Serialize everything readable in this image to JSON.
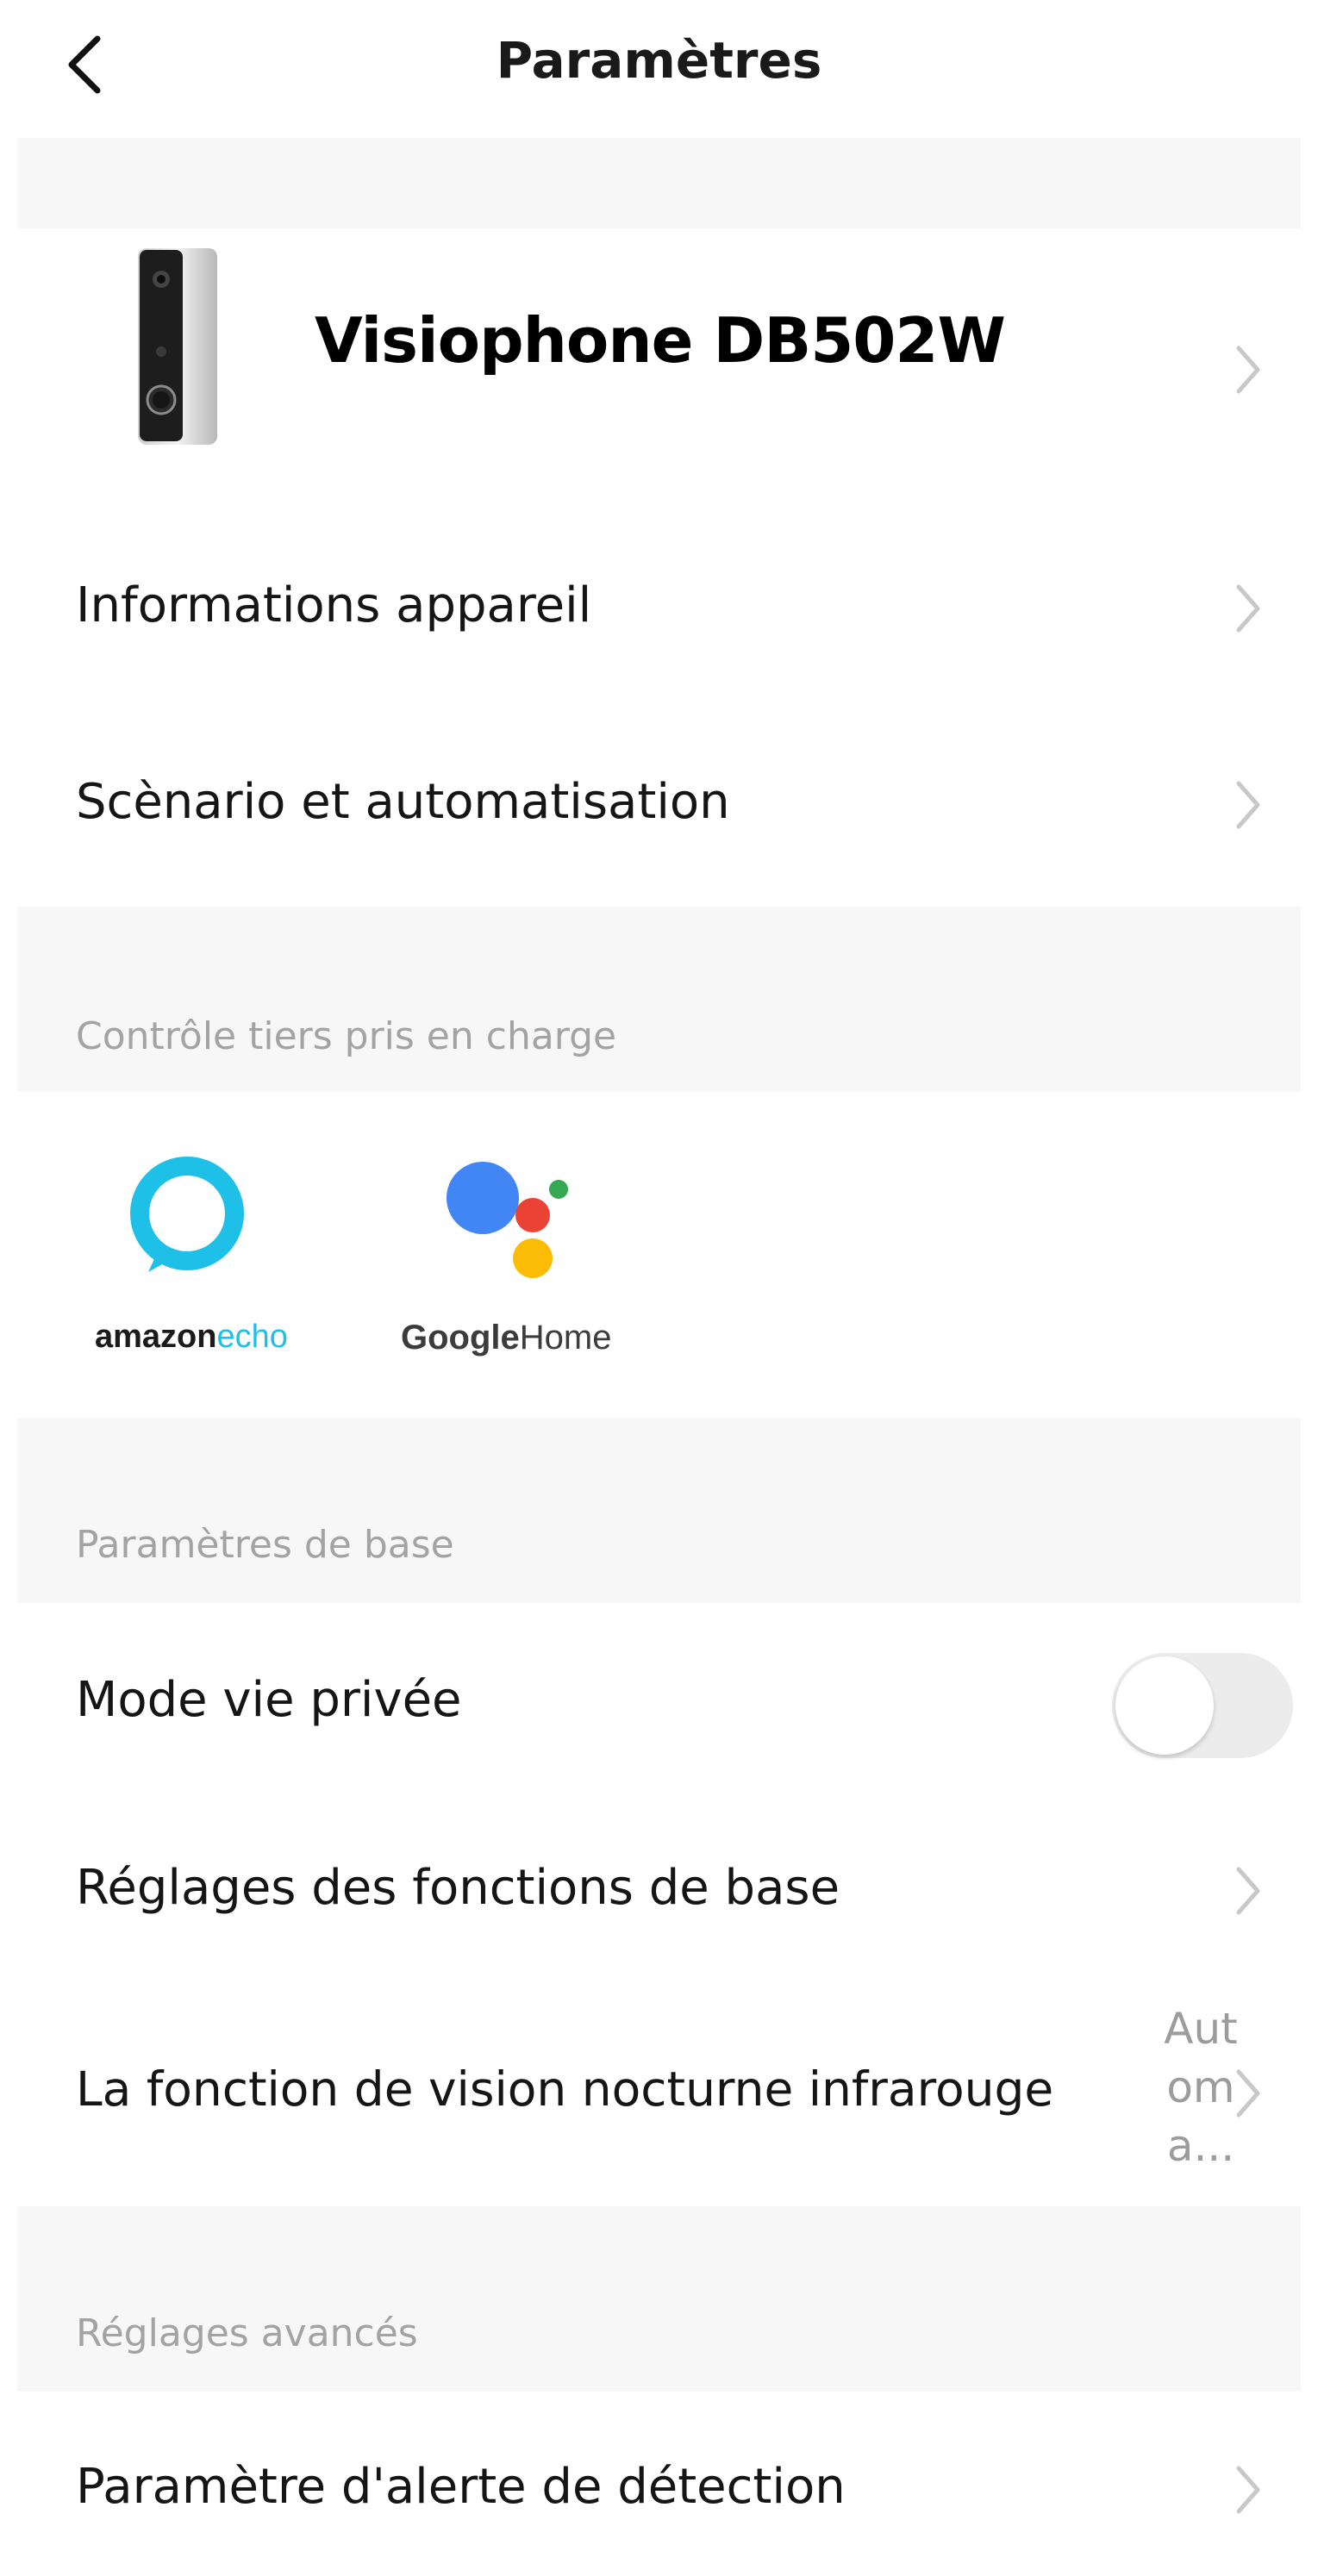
{
  "header": {
    "title": "Paramètres",
    "back_icon": "chevron-left-icon"
  },
  "device": {
    "name": "Visiophone DB502W",
    "image": "doorbell-device-image"
  },
  "menu_top": [
    {
      "label": "Informations appareil"
    },
    {
      "label": "Scènario et automatisation"
    }
  ],
  "third_party": {
    "section_title": "Contrôle tiers pris en charge",
    "amazon": {
      "word": "amazon",
      "suffix": "echo",
      "ring_color": "#1ec0e8"
    },
    "google": {
      "word": "Google",
      "suffix": "Home",
      "dot_colors": [
        "#4285f4",
        "#ea4335",
        "#fbbc05",
        "#34a853"
      ]
    }
  },
  "basic": {
    "section_title": "Paramètres de base",
    "privacy": {
      "label": "Mode vie privée",
      "enabled": false
    },
    "functions": {
      "label": "Réglages des fonctions de base"
    },
    "night_vision": {
      "label": "La fonction de vision nocturne infrarouge",
      "value": "Aut om a..."
    }
  },
  "advanced": {
    "section_title": "Réglages avancés",
    "detection": {
      "label": "Paramètre d'alerte de détection"
    }
  },
  "colors": {
    "section_bg": "#f7f7f7",
    "toggle_off": "#ececec",
    "chevron": "#c8c8c8",
    "secondary_text": "#a3a3a3"
  }
}
